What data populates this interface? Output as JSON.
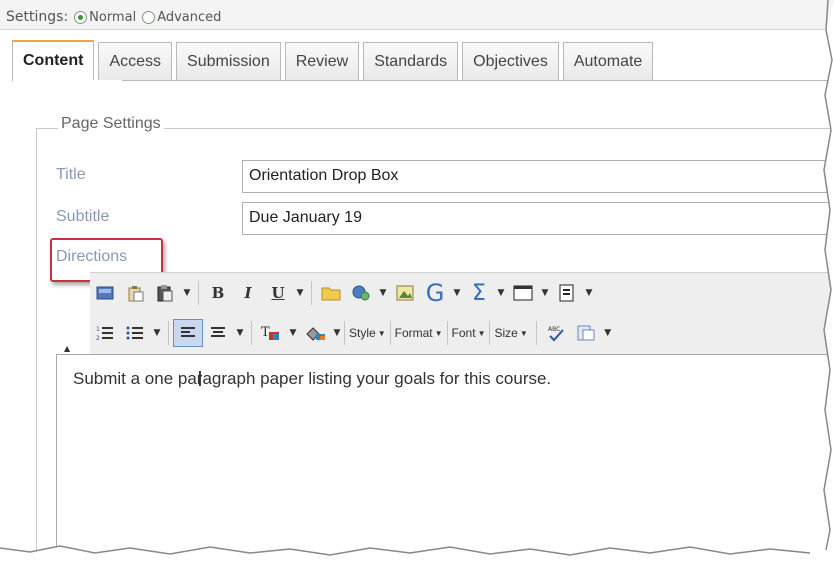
{
  "settings": {
    "label": "Settings:",
    "options": [
      {
        "label": "Normal",
        "selected": true
      },
      {
        "label": "Advanced",
        "selected": false
      }
    ]
  },
  "tabs": [
    {
      "label": "Content",
      "active": true
    },
    {
      "label": "Access",
      "active": false
    },
    {
      "label": "Submission",
      "active": false
    },
    {
      "label": "Review",
      "active": false
    },
    {
      "label": "Standards",
      "active": false
    },
    {
      "label": "Objectives",
      "active": false
    },
    {
      "label": "Automate",
      "active": false
    }
  ],
  "page_settings": {
    "legend": "Page Settings",
    "title_label": "Title",
    "title_value": "Orientation Drop Box",
    "subtitle_label": "Subtitle",
    "subtitle_value": "Due January 19",
    "directions_label": "Directions"
  },
  "toolbar": {
    "style_label": "Style",
    "format_label": "Format",
    "font_label": "Font",
    "size_label": "Size",
    "bold_glyph": "B",
    "italic_glyph": "I",
    "underline_glyph": "U",
    "sigma_glyph": "Σ",
    "g_glyph": "G"
  },
  "editor": {
    "text": "Submit a one paragraph paper listing your goals for this course."
  },
  "colors": {
    "highlight_border": "#c8323a",
    "label_color": "#8a9ab5",
    "active_tab_accent": "#f0a640"
  }
}
